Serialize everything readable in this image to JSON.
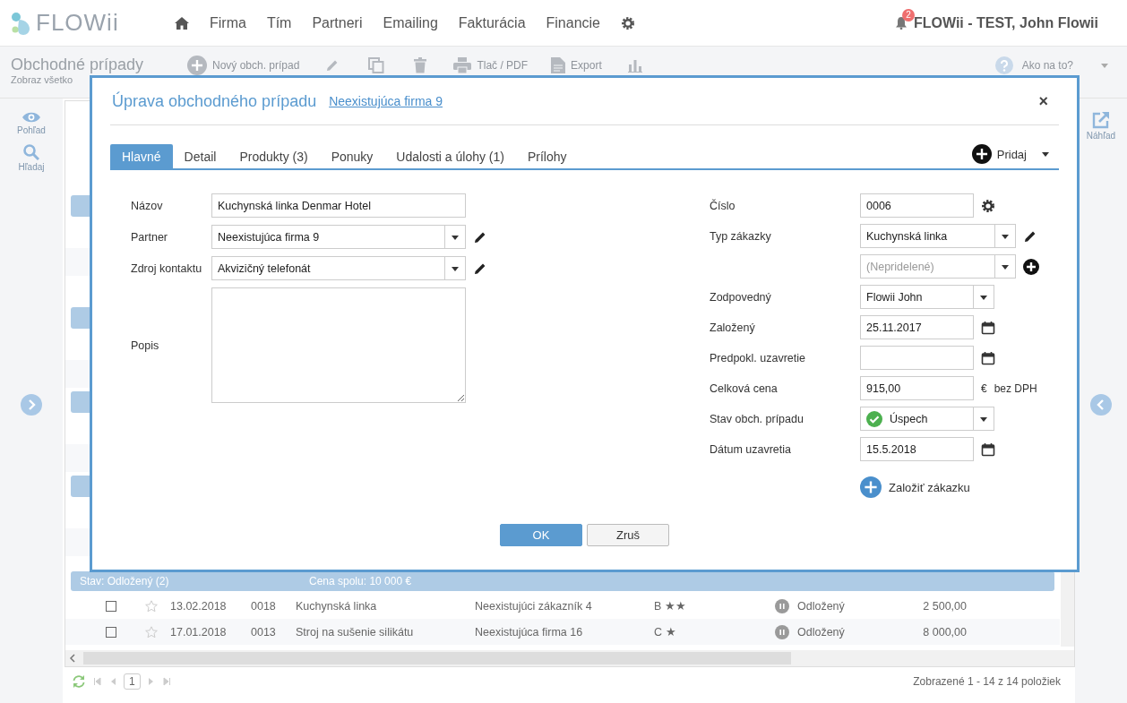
{
  "header": {
    "logo": "FLOWii",
    "nav": [
      {
        "kind": "home"
      },
      {
        "kind": "link",
        "label": "Firma"
      },
      {
        "kind": "link",
        "label": "Tím"
      },
      {
        "kind": "link",
        "label": "Partneri"
      },
      {
        "kind": "link",
        "label": "Emailing"
      },
      {
        "kind": "link",
        "label": "Fakturácia"
      },
      {
        "kind": "link",
        "label": "Financie"
      },
      {
        "kind": "settings"
      }
    ],
    "notifications": "2",
    "user": "FLOWii - TEST, John Flowii"
  },
  "toolbar": {
    "title": "Obchodné prípady",
    "subtitle": "Zobraz všetko",
    "actions": [
      {
        "kind": "add",
        "label": "Nový obch. prípad"
      },
      {
        "kind": "edit"
      },
      {
        "kind": "copy"
      },
      {
        "kind": "delete"
      },
      {
        "kind": "print",
        "label": "Tlač / PDF"
      },
      {
        "kind": "export",
        "label": "Export"
      },
      {
        "kind": "chart"
      }
    ],
    "help": "Ako na to?"
  },
  "left_sidebar": [
    {
      "kind": "view",
      "label": "Pohľad"
    },
    {
      "kind": "search",
      "label": "Hľadaj"
    }
  ],
  "right_sidebar": [
    {
      "kind": "preview",
      "label": "Náhľad"
    }
  ],
  "table": {
    "background_rows": [
      {
        "kind": "blank"
      },
      {
        "kind": "group"
      },
      {
        "kind": "blank"
      },
      {
        "kind": "stripe"
      },
      {
        "kind": "blank"
      },
      {
        "kind": "group"
      },
      {
        "kind": "blank"
      },
      {
        "kind": "stripe"
      },
      {
        "kind": "group"
      },
      {
        "kind": "blank"
      },
      {
        "kind": "stripe"
      },
      {
        "kind": "group"
      },
      {
        "kind": "blank"
      },
      {
        "kind": "stripe"
      }
    ],
    "group": {
      "label": "Stav: Odložený (2)",
      "total": "Cena spolu: 10 000 €"
    },
    "rows": [
      {
        "checked": false,
        "favorite": false,
        "date": "13.02.2018",
        "number": "0018",
        "name": "Kuchynská linka",
        "customer": "Neexistujúci zákazník 4",
        "priority": "B ★★",
        "status": "Odložený",
        "price": "2 500,00"
      },
      {
        "checked": false,
        "favorite": false,
        "date": "17.01.2018",
        "number": "0013",
        "name": "Stroj na sušenie silikátu",
        "customer": "Neexistujúca firma 16",
        "priority": "C ★",
        "status": "Odložený",
        "price": "8 000,00"
      }
    ]
  },
  "pager": {
    "page": "1",
    "summary": "Zobrazené 1 - 14 z 14 položiek"
  },
  "dialog": {
    "title": "Úprava obchodného prípadu",
    "link": "Neexistujúca firma 9",
    "close": "×",
    "tabs": [
      {
        "label": "Hlavné",
        "selected": true
      },
      {
        "label": "Detail",
        "selected": false
      },
      {
        "label": "Produkty (3)",
        "selected": false
      },
      {
        "label": "Ponuky",
        "selected": false
      },
      {
        "label": "Udalosti a úlohy (1)",
        "selected": false
      },
      {
        "label": "Prílohy",
        "selected": false
      }
    ],
    "add_button": "Pridaj",
    "left_fields": [
      {
        "label": "Názov",
        "kind": "text",
        "value": "Kuchynská linka Denmar Hotel"
      },
      {
        "label": "Partner",
        "kind": "select",
        "value": "Neexistujúca firma 9",
        "action": {
          "kind": "edit"
        }
      },
      {
        "label": "Zdroj kontaktu",
        "kind": "select",
        "value": "Akvizičný telefonát",
        "action": {
          "kind": "edit"
        }
      },
      {
        "label": "Popis",
        "kind": "textarea"
      }
    ],
    "right_fields": [
      {
        "label": "Číslo",
        "kind": "text",
        "value": "0006",
        "action": {
          "kind": "settings"
        }
      },
      {
        "label": "Typ zákazky",
        "kind": "select",
        "value": "Kuchynská linka",
        "action": {
          "kind": "edit"
        }
      },
      {
        "kind": "select",
        "placeholder": "(Nepridelené)",
        "action": {
          "kind": "add"
        }
      },
      {
        "label": "Zodpovedný",
        "kind": "select",
        "value": "Flowii John"
      },
      {
        "label": "Založený",
        "kind": "date",
        "value": "25.11.2017"
      },
      {
        "label": "Predpokl. uzavretie",
        "kind": "date"
      },
      {
        "label": "Celková cena",
        "kind": "price",
        "value": "915,00",
        "currency": "€",
        "note": "bez DPH"
      },
      {
        "label": "Stav obch. prípadu",
        "kind": "status",
        "value": "Úspech"
      },
      {
        "label": "Dátum uzavretia",
        "kind": "date",
        "value": "15.5.2018"
      }
    ],
    "create_button": "Založiť zákazku",
    "buttons": [
      {
        "kind": "primary",
        "label": "OK"
      },
      {
        "kind": "secondary",
        "label": "Zruš"
      }
    ]
  }
}
